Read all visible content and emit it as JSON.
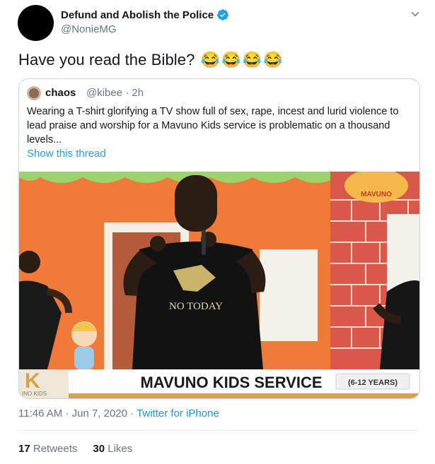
{
  "author": {
    "name": "Defund and Abolish the Police",
    "handle": "@NonieMG"
  },
  "tweet_text": "Have you read the Bible?",
  "emojis": [
    "😂",
    "😂",
    "😂",
    "😂"
  ],
  "quoted": {
    "name": "chaos",
    "handle": "@kibee · 2h",
    "text": "Wearing a T-shirt glorifying a TV show full of sex, rape, incest and lurid violence to lead praise and worship for a Mavuno Kids service is problematic on a thousand levels...",
    "show_thread": "Show this thread",
    "media": {
      "banner": "MAVUNO KIDS SERVICE",
      "age_range": "(6-12 YEARS)",
      "channel_logo": "K",
      "channel_subtext": "INO KIDS",
      "sign": "MAVUNO",
      "shirt_text": "NO TODAY"
    }
  },
  "timestamp": "11:46 AM · Jun 7, 2020 · ",
  "source": "Twitter for iPhone",
  "stats": {
    "retweets_count": "17",
    "retweets_label": "Retweets",
    "likes_count": "30",
    "likes_label": "Likes"
  },
  "colors": {
    "link": "#1da1f2",
    "muted": "#657786",
    "verified": "#1da1f2"
  }
}
